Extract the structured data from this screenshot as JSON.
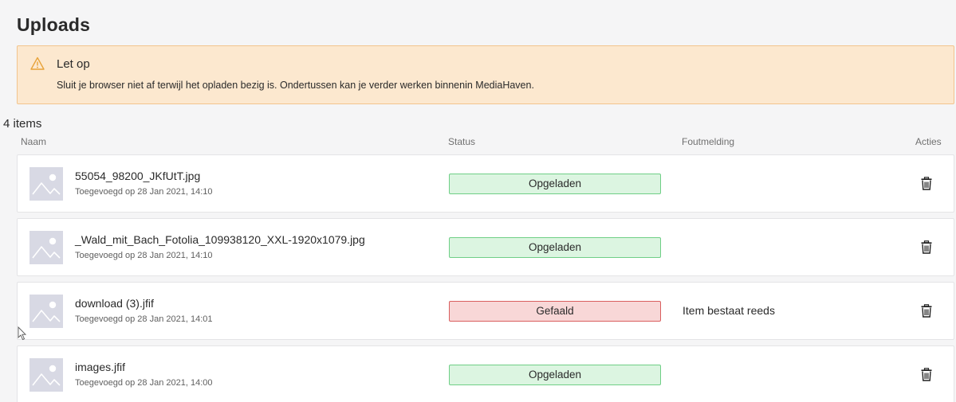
{
  "page": {
    "title": "Uploads"
  },
  "alert": {
    "icon": "warning-icon",
    "title": "Let op",
    "text": "Sluit je browser niet af terwijl het opladen bezig is. Ondertussen kan je verder werken binnenin MediaHaven."
  },
  "list": {
    "count": "4 items",
    "columns": {
      "name": "Naam",
      "status": "Status",
      "error": "Foutmelding",
      "actions": "Acties"
    },
    "items": [
      {
        "name": "55054_98200_JKfUtT.jpg",
        "date": "Toegevoegd op 28 Jan 2021, 14:10",
        "status": "Opgeladen",
        "state": "ok",
        "error": ""
      },
      {
        "name": "_Wald_mit_Bach_Fotolia_109938120_XXL-1920x1079.jpg",
        "date": "Toegevoegd op 28 Jan 2021, 14:10",
        "status": "Opgeladen",
        "state": "ok",
        "error": ""
      },
      {
        "name": "download (3).jfif",
        "date": "Toegevoegd op 28 Jan 2021, 14:01",
        "status": "Gefaald",
        "state": "fail",
        "error": "Item bestaat reeds"
      },
      {
        "name": "images.jfif",
        "date": "Toegevoegd op 28 Jan 2021, 14:00",
        "status": "Opgeladen",
        "state": "ok",
        "error": ""
      }
    ]
  },
  "colors": {
    "success_bg": "#dcf5e1",
    "success_border": "#6fcf86",
    "fail_bg": "#f8d7d7",
    "fail_border": "#d95f5f",
    "warning_bg": "#fce8cf",
    "warning_border": "#f2c48d"
  }
}
